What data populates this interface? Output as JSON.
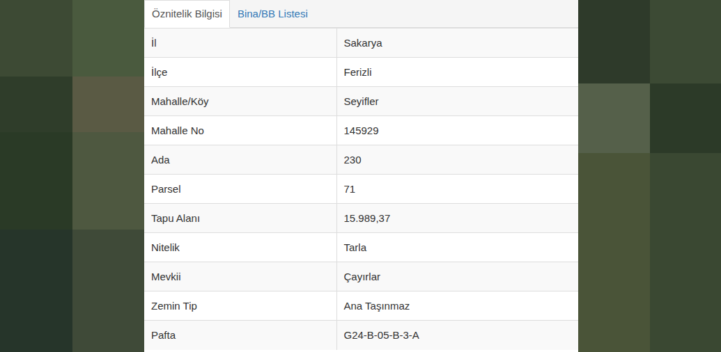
{
  "tabs": [
    {
      "label": "Öznitelik Bilgisi",
      "selected": true
    },
    {
      "label": "Bina/BB Listesi",
      "selected": false
    }
  ],
  "table": {
    "rows": [
      [
        "İl",
        "Sakarya"
      ],
      [
        "İlçe",
        "Ferizli"
      ],
      [
        "Mahalle/Köy",
        "Seyifler"
      ],
      [
        "Mahalle No",
        "145929"
      ],
      [
        "Ada",
        "230"
      ],
      [
        "Parsel",
        "71"
      ],
      [
        "Tapu Alanı",
        "15.989,37"
      ],
      [
        "Nitelik",
        "Tarla"
      ],
      [
        "Mevkii",
        "Çayırlar"
      ],
      [
        "Zemin Tip",
        "Ana Taşınmaz"
      ],
      [
        "Pafta",
        "G24-B-05-B-3-A"
      ]
    ]
  }
}
